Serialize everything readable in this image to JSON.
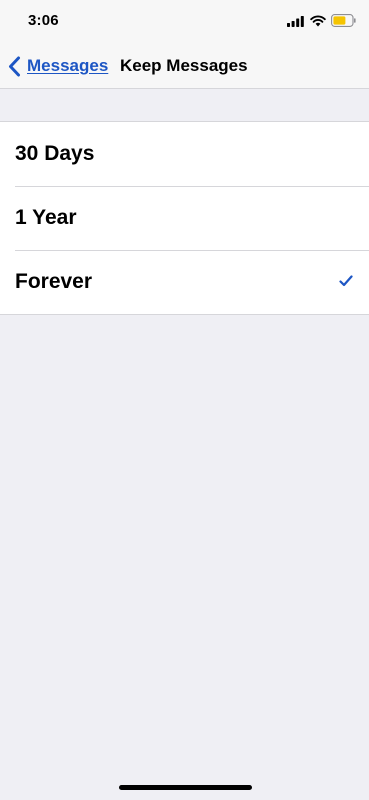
{
  "status_bar": {
    "time": "3:06",
    "icons": [
      "signal-icon",
      "wifi-icon",
      "battery-icon"
    ]
  },
  "nav": {
    "back_label": "Messages",
    "back_icon": "chevron-left-icon",
    "title": "Keep Messages"
  },
  "options": [
    {
      "label": "30 Days",
      "selected": false
    },
    {
      "label": "1 Year",
      "selected": false
    },
    {
      "label": "Forever",
      "selected": true
    }
  ],
  "colors": {
    "accent": "#1d56c4",
    "background": "#efeff4",
    "battery_fill": "#f5c400"
  }
}
